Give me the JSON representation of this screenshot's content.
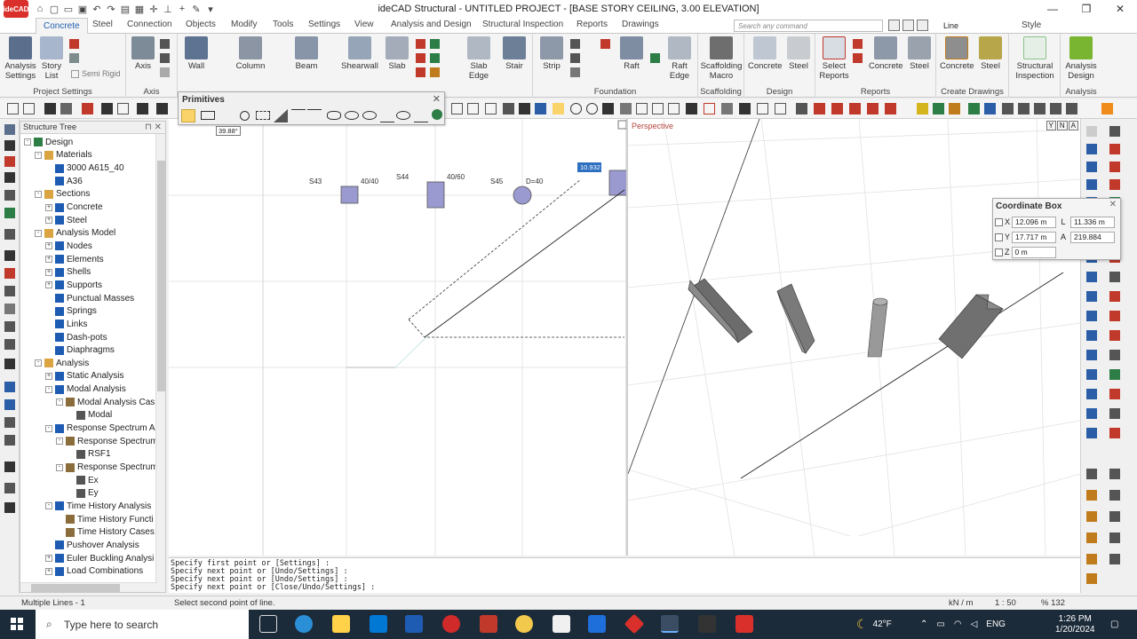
{
  "app": {
    "title": "ideCAD Structural - UNTITLED PROJECT - [BASE STORY CEILING,  3.00 ELEVATION]",
    "logo_text": "ideCAD"
  },
  "menu": {
    "tabs": [
      "Concrete",
      "Steel",
      "Connection",
      "Objects",
      "Modify",
      "Tools",
      "Settings",
      "View",
      "Analysis and Design",
      "Structural Inspection",
      "Reports",
      "Drawings"
    ],
    "active_tab": "Concrete",
    "search_placeholder": "Search any command",
    "line_type": "Line",
    "style_label": "Style"
  },
  "ribbon": {
    "groups": [
      {
        "label": "Project Settings",
        "buttons": [
          "Analysis Settings",
          "Story List"
        ],
        "extra": "Semi Rigid"
      },
      {
        "label": "Axis",
        "buttons": [
          "Axis"
        ]
      },
      {
        "label": "",
        "buttons": [
          "Wall",
          "Column",
          "Beam",
          "Shearwall",
          "Slab",
          "Slab Edge",
          "Stair"
        ]
      },
      {
        "label": "Foundation",
        "buttons": [
          "Strip",
          "Raft",
          "Raft Edge"
        ]
      },
      {
        "label": "Scaffolding",
        "buttons": [
          "Scaffolding Macro"
        ]
      },
      {
        "label": "Design",
        "buttons": [
          "Concrete",
          "Steel"
        ]
      },
      {
        "label": "Reports",
        "buttons": [
          "Select Reports",
          "Concrete",
          "Steel"
        ]
      },
      {
        "label": "Create Drawings",
        "buttons": [
          "Concrete",
          "Steel"
        ]
      },
      {
        "label": "",
        "buttons": [
          "Structural Inspection"
        ]
      },
      {
        "label": "Analysis",
        "buttons": [
          "Analysis Design"
        ]
      }
    ]
  },
  "primitives": {
    "title": "Primitives",
    "angle_tooltip": "39.88°"
  },
  "tree": {
    "title": "Structure Tree",
    "nodes": [
      {
        "label": "Design",
        "level": 0,
        "exp": "-"
      },
      {
        "label": "Materials",
        "level": 1,
        "exp": "-"
      },
      {
        "label": "3000 A615_40",
        "level": 2,
        "exp": ""
      },
      {
        "label": "A36",
        "level": 2,
        "exp": ""
      },
      {
        "label": "Sections",
        "level": 1,
        "exp": "-"
      },
      {
        "label": "Concrete",
        "level": 2,
        "exp": "+"
      },
      {
        "label": "Steel",
        "level": 2,
        "exp": "+"
      },
      {
        "label": "Analysis Model",
        "level": 1,
        "exp": "-"
      },
      {
        "label": "Nodes",
        "level": 2,
        "exp": "+"
      },
      {
        "label": "Elements",
        "level": 2,
        "exp": "+"
      },
      {
        "label": "Shells",
        "level": 2,
        "exp": "+"
      },
      {
        "label": "Supports",
        "level": 2,
        "exp": "+"
      },
      {
        "label": "Punctual Masses",
        "level": 2,
        "exp": ""
      },
      {
        "label": "Springs",
        "level": 2,
        "exp": ""
      },
      {
        "label": "Links",
        "level": 2,
        "exp": ""
      },
      {
        "label": "Dash-pots",
        "level": 2,
        "exp": ""
      },
      {
        "label": "Diaphragms",
        "level": 2,
        "exp": ""
      },
      {
        "label": "Analysis",
        "level": 1,
        "exp": "-"
      },
      {
        "label": "Static Analysis",
        "level": 2,
        "exp": "+"
      },
      {
        "label": "Modal Analysis",
        "level": 2,
        "exp": "-"
      },
      {
        "label": "Modal Analysis Cas",
        "level": 3,
        "exp": "-"
      },
      {
        "label": "Modal",
        "level": 4,
        "exp": ""
      },
      {
        "label": "Response Spectrum A",
        "level": 2,
        "exp": "-"
      },
      {
        "label": "Response Spectrum",
        "level": 3,
        "exp": "-"
      },
      {
        "label": "RSF1",
        "level": 4,
        "exp": ""
      },
      {
        "label": "Response Spectrum",
        "level": 3,
        "exp": "-"
      },
      {
        "label": "Ex",
        "level": 4,
        "exp": ""
      },
      {
        "label": "Ey",
        "level": 4,
        "exp": ""
      },
      {
        "label": "Time History Analysis",
        "level": 2,
        "exp": "-"
      },
      {
        "label": "Time History Functi",
        "level": 3,
        "exp": ""
      },
      {
        "label": "Time History Cases",
        "level": 3,
        "exp": ""
      },
      {
        "label": "Pushover Analysis",
        "level": 2,
        "exp": ""
      },
      {
        "label": "Euler Buckling Analysi",
        "level": 2,
        "exp": "+"
      },
      {
        "label": "Load Combinations",
        "level": 2,
        "exp": "+"
      }
    ]
  },
  "plan": {
    "labels": [
      {
        "text": "S43"
      },
      {
        "text": "40/40"
      },
      {
        "text": "S44"
      },
      {
        "text": "40/60"
      },
      {
        "text": "S45"
      },
      {
        "text": "D=40"
      }
    ],
    "length_badge": "10.932"
  },
  "perspective": {
    "label": "Perspective",
    "cube": [
      "Y",
      "N",
      "A"
    ]
  },
  "coordinate_box": {
    "title": "Coordinate Box",
    "x_label": "X",
    "x_value": "12.096 m",
    "y_label": "Y",
    "y_value": "17.717 m",
    "z_label": "Z",
    "z_value": "0 m",
    "l_label": "L",
    "l_value": "11.336 m",
    "a_label": "A",
    "a_value": "219.884"
  },
  "command_lines": [
    "Specify first point or [Settings] :",
    "Specify next point or [Undo/Settings] :",
    "Specify next point or [Undo/Settings] :",
    "Specify next point or [Close/Undo/Settings] :"
  ],
  "status": {
    "left": "Multiple Lines - 1",
    "prompt": "Select second point of line.",
    "units": "kN / m",
    "scale": "1 : 50",
    "zoom": "% 132"
  },
  "taskbar": {
    "search": "Type here to search",
    "temp": "42°F",
    "lang": "ENG",
    "time": "1:26 PM",
    "date": "1/20/2024"
  },
  "colors": {
    "accent": "#1f5fb0",
    "taskbar": "#1c2b3a",
    "logo": "#d9302b",
    "column_fill": "#9a9ad0",
    "persp_label": "#b4443a"
  }
}
